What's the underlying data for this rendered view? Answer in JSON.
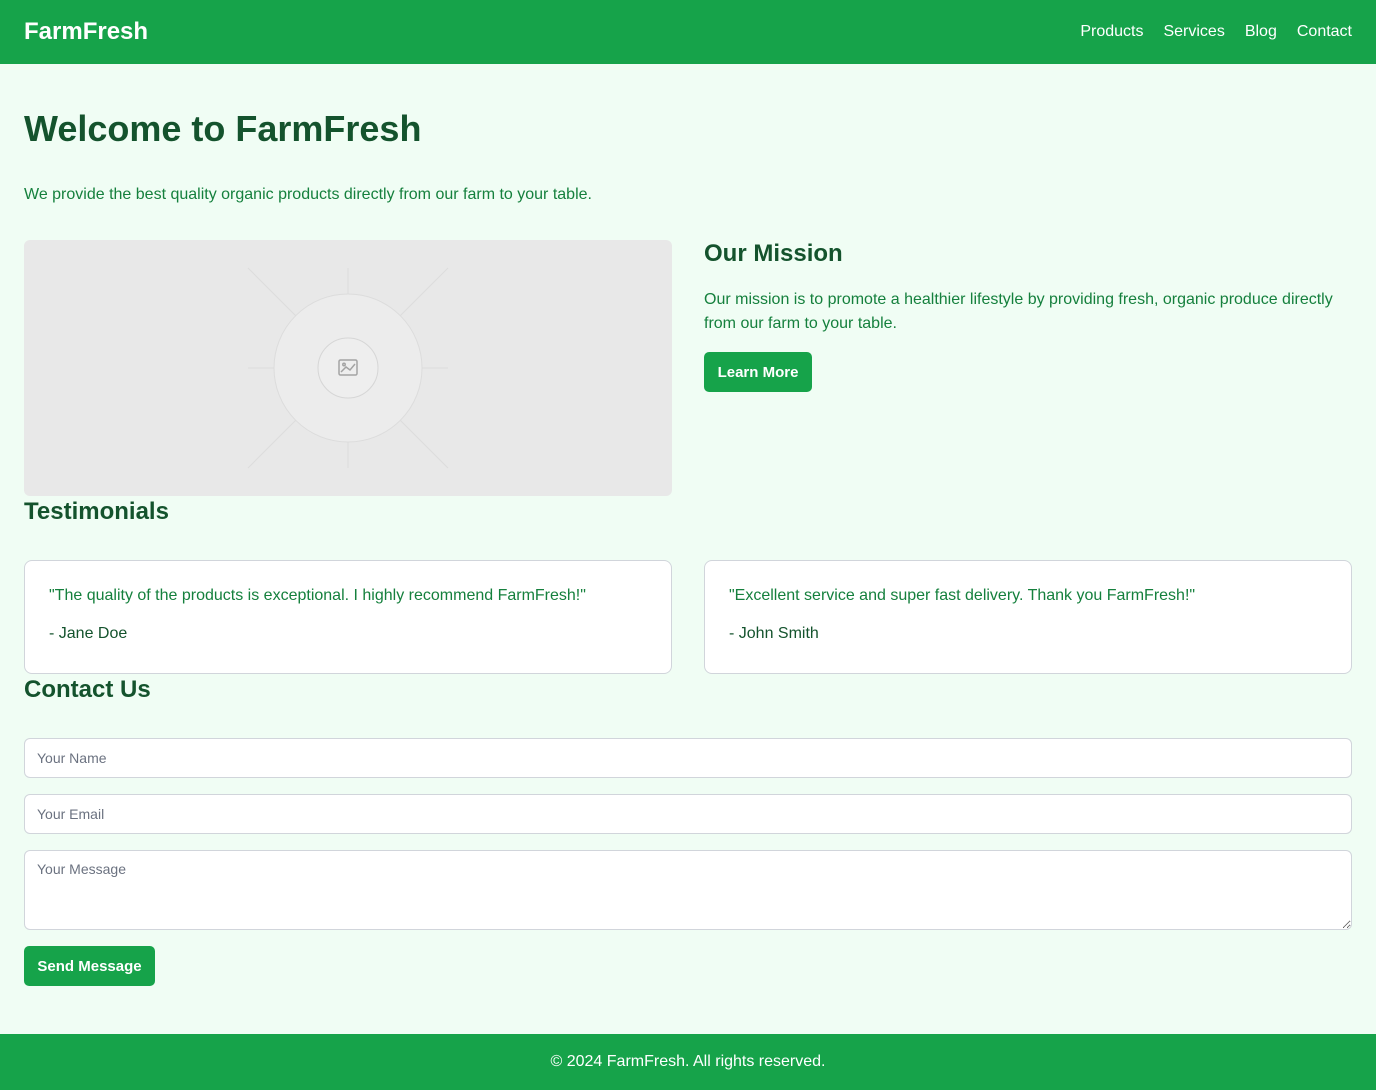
{
  "header": {
    "logo": "FarmFresh",
    "nav": [
      "Products",
      "Services",
      "Blog",
      "Contact"
    ]
  },
  "hero": {
    "title": "Welcome to FarmFresh",
    "subtitle": "We provide the best quality organic products directly from our farm to your table."
  },
  "image_placeholder": {
    "icon": "image-icon"
  },
  "mission": {
    "title": "Our Mission",
    "text": "Our mission is to promote a healthier lifestyle by providing fresh, organic produce directly from our farm to your table.",
    "button_label": "Learn More"
  },
  "testimonials": {
    "title": "Testimonials",
    "items": [
      {
        "quote": "\"The quality of the products is exceptional. I highly recommend FarmFresh!\"",
        "author": "- Jane Doe"
      },
      {
        "quote": "\"Excellent service and super fast delivery. Thank you FarmFresh!\"",
        "author": "- John Smith"
      }
    ]
  },
  "contact": {
    "title": "Contact Us",
    "name_placeholder": "Your Name",
    "email_placeholder": "Your Email",
    "message_placeholder": "Your Message",
    "send_label": "Send Message"
  },
  "footer": {
    "text": "© 2024 FarmFresh. All rights reserved."
  },
  "colors": {
    "primary": "#16a34a",
    "background": "#f0fdf4",
    "heading": "#14532d",
    "text": "#15803d"
  }
}
